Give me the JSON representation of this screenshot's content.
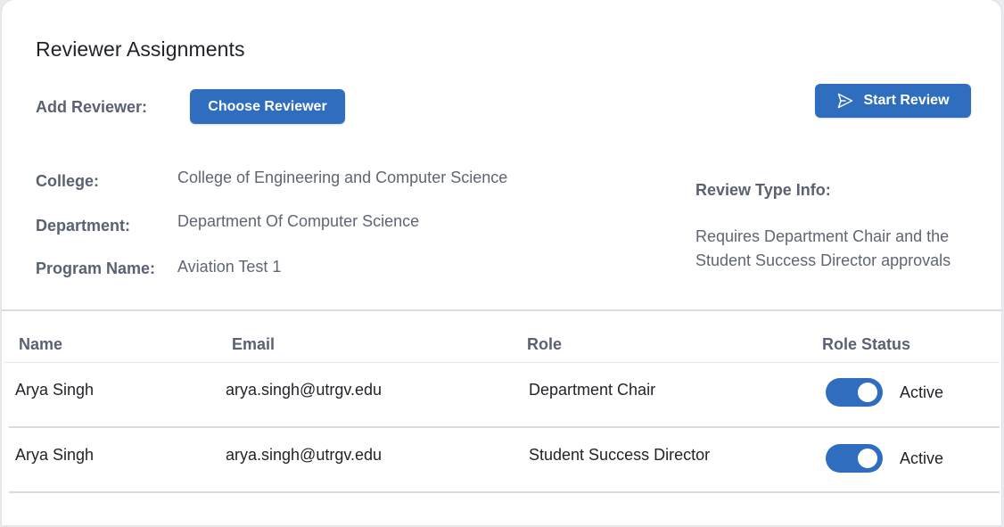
{
  "header": {
    "title": "Reviewer Assignments",
    "add_reviewer_label": "Add Reviewer:",
    "choose_reviewer_button": "Choose Reviewer",
    "start_review_button": "Start Review"
  },
  "details": {
    "college_label": "College:",
    "college_value": "College of Engineering and Computer Science",
    "department_label": "Department:",
    "department_value": "Department Of Computer Science",
    "program_label": "Program Name:",
    "program_value": "Aviation Test 1",
    "review_type_label": "Review Type Info:",
    "review_type_line1": "Requires Department Chair and the",
    "review_type_line2": "Student Success Director approvals"
  },
  "table": {
    "columns": [
      "Name",
      "Email",
      "Role",
      "Role Status"
    ],
    "rows": [
      {
        "name": "Arya Singh",
        "email": "arya.singh@utrgv.edu",
        "role": "Department Chair",
        "status": "Active",
        "active": true
      },
      {
        "name": "Arya Singh",
        "email": "arya.singh@utrgv.edu",
        "role": "Student Success Director",
        "status": "Active",
        "active": true
      }
    ]
  },
  "icons": {
    "start_review": "send-icon"
  },
  "colors": {
    "primary": "#2f6dbe",
    "label": "#5a6172",
    "text": "#1f2328",
    "divider": "#d7dbe2"
  }
}
